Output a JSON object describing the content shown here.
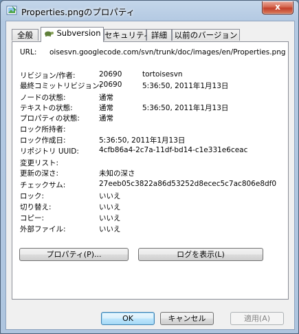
{
  "window": {
    "title": "Properties.pngのプロパティ",
    "close_label": "x"
  },
  "tabs": [
    {
      "label": "全般"
    },
    {
      "label": "Subversion"
    },
    {
      "label": "セキュリティ"
    },
    {
      "label": "詳細"
    },
    {
      "label": "以前のバージョン"
    }
  ],
  "props": {
    "url_label": "URL:",
    "url_value": "oisesvn.googlecode.com/svn/trunk/doc/images/en/Properties.png",
    "revision_label": "リビジョン/作者:",
    "revision_value": "20690",
    "revision_author": "tortoisesvn",
    "last_commit_label": "最終コミットリビジョン:",
    "last_commit_value": "20690",
    "last_commit_date": "5:36:50, 2011年1月13日",
    "node_status_label": "ノードの状態:",
    "node_status_value": "通常",
    "text_status_label": "テキストの状態:",
    "text_status_value": "通常",
    "text_status_date": "5:36:50, 2011年1月13日",
    "prop_status_label": "プロパティの状態:",
    "prop_status_value": "通常",
    "lock_owner_label": "ロック所持者:",
    "lock_created_label": "ロック作成日:",
    "lock_created_value": "5:36:50, 2011年1月13日",
    "repo_uuid_label": "リポジトリ UUID:",
    "repo_uuid_value": "4cfb86a4-2c7a-11df-bd14-c1e331e6ceac",
    "changelist_label": "変更リスト:",
    "depth_label": "更新の深さ:",
    "depth_value": "未知の深さ",
    "checksum_label": "チェックサム:",
    "checksum_value": "27eeb05c3822a86d53252d8ecec5c7ac806e8df0",
    "lock_label": "ロック:",
    "lock_value": "いいえ",
    "switched_label": "切り替え:",
    "switched_value": "いいえ",
    "copied_label": "コピー:",
    "copied_value": "いいえ",
    "external_label": "外部ファイル:",
    "external_value": "いいえ"
  },
  "actions": {
    "properties_button": "プロパティ(P)...",
    "show_log_button": "ログを表示(L)"
  },
  "footer": {
    "ok": "OK",
    "cancel": "キャンセル",
    "apply": "適用(A)"
  }
}
